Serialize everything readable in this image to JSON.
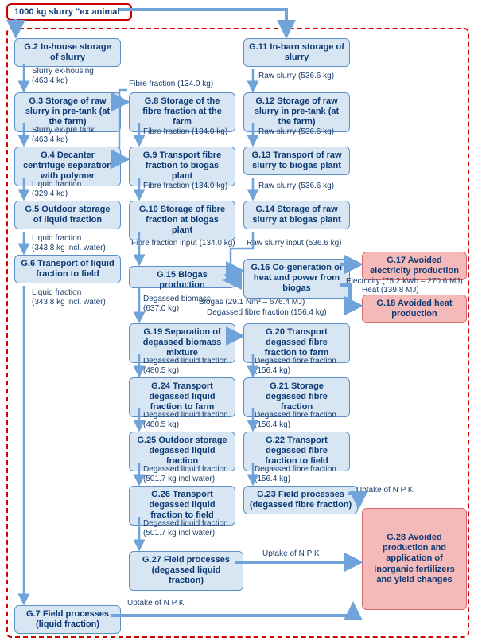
{
  "start": "1000 kg slurry \"ex animal\"",
  "nodes": {
    "g2": "G.2 In-house storage of slurry",
    "g3": "G.3 Storage of raw slurry in pre-tank (at the farm)",
    "g4": "G.4 Decanter centrifuge separation with polymer",
    "g5": "G.5 Outdoor storage of liquid fraction",
    "g6": "G.6 Transport of liquid fraction to field",
    "g7": "G.7 Field processes (liquid fraction)",
    "g8": "G.8 Storage of the fibre fraction at the farm",
    "g9": "G.9 Transport fibre fraction to biogas plant",
    "g10": "G.10 Storage of fibre fraction at biogas plant",
    "g11": "G.11 In-barn storage of slurry",
    "g12": "G.12 Storage of raw slurry in pre-tank (at the farm)",
    "g13": "G.13 Transport of raw slurry to biogas plant",
    "g14": "G.14 Storage of raw slurry at biogas plant",
    "g15": "G.15 Biogas production",
    "g16": "G.16 Co-generation of heat and power from biogas",
    "g17": "G.17 Avoided electricity production",
    "g18": "G.18 Avoided heat production",
    "g19": "G.19 Separation of degassed biomass mixture",
    "g20": "G.20 Transport degassed fibre fraction to farm",
    "g21": "G.21 Storage degassed fibre fraction",
    "g22": "G.22 Transport degassed fibre fraction to field",
    "g23": "G.23 Field processes (degassed fibre fraction)",
    "g24": "G.24 Transport degassed liquid fraction to farm",
    "g25": "G.25 Outdoor storage degassed liquid fraction",
    "g26": "G.26 Transport degassed liquid fraction to field",
    "g27": "G.27 Field processes (degassed liquid fraction)",
    "g28": "G.28 Avoided production and application of inorganic fertilizers and yield changes"
  },
  "labels": {
    "l1": "Slurry ex-housing",
    "l1b": "(463.4 kg)",
    "l2": "Slurry ex-pre tank",
    "l2b": "(463.4 kg)",
    "l3": "Liquid fraction",
    "l3b": "(329.4 kg)",
    "l4": "Liquid fraction",
    "l4b": "(343.8 kg incl. water)",
    "l5": "Liquid fraction",
    "l5b": "(343.8 kg incl. water)",
    "l6": "Fibre fraction (134.0 kg)",
    "l7": "Fibre fraction (134.0 kg)",
    "l8": "Fibre fraction (134.0 kg)",
    "l9": "Fibre fraction input (134.0 kg)",
    "l10": "Raw slurry (536.6 kg)",
    "l11": "Raw slurry (536.6 kg)",
    "l12": "Raw slurry (536.6 kg)",
    "l13": "Raw slurry input (536.6 kg)",
    "l14": "Biogas (29.1 Nm³ – 676.4 MJ)",
    "l15": "Electricity (75.2 kWh – 270.6 MJ)",
    "l16": "Heat (139.8 MJ)",
    "l17": "Degassed biomass",
    "l17b": "(637.0 kg)",
    "l18": "Degassed fibre fraction (156.4 kg)",
    "l19": "Degassed liquid fraction",
    "l19b": "(480.5 kg)",
    "l20": "Degassed liquid fraction",
    "l20b": "(480.5 kg)",
    "l21": "Degassed liquid fraction",
    "l21b": "(501.7 kg incl water)",
    "l22": "Degassed liquid fraction",
    "l22b": "(501.7 kg incl water)",
    "l23": "Degassed fibre fraction",
    "l23b": "(156.4 kg)",
    "l24": "Degassed fibre fraction",
    "l24b": "(156.4 kg)",
    "l25": "Degassed fibre fraction",
    "l25b": "(156.4 kg)",
    "l26": "Uptake of N P K",
    "l27": "Uptake of N P K",
    "l28": "Uptake of N P K"
  }
}
